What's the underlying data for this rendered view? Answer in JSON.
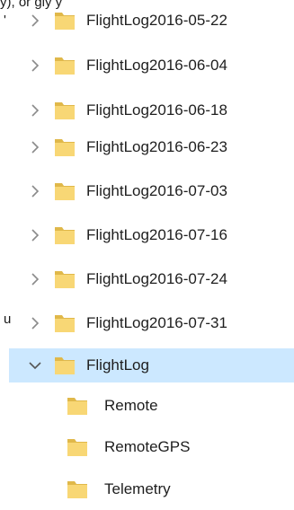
{
  "background_text": {
    "fragment_1": "y), or     gly y",
    "fragment_2": "'",
    "fragment_3": "u"
  },
  "tree": {
    "items": [
      {
        "label": "FlightLog2016-05-22",
        "expanded": false,
        "selected": false
      },
      {
        "label": "FlightLog2016-06-04",
        "expanded": false,
        "selected": false
      },
      {
        "label": "FlightLog2016-06-18",
        "expanded": false,
        "selected": false
      },
      {
        "label": "FlightLog2016-06-23",
        "expanded": false,
        "selected": false
      },
      {
        "label": "FlightLog2016-07-03",
        "expanded": false,
        "selected": false
      },
      {
        "label": "FlightLog2016-07-16",
        "expanded": false,
        "selected": false
      },
      {
        "label": "FlightLog2016-07-24",
        "expanded": false,
        "selected": false
      },
      {
        "label": "FlightLog2016-07-31",
        "expanded": false,
        "selected": false
      },
      {
        "label": "FlightLog",
        "expanded": true,
        "selected": true
      }
    ],
    "children": [
      {
        "label": "Remote"
      },
      {
        "label": "RemoteGPS"
      },
      {
        "label": "Telemetry"
      }
    ]
  },
  "colors": {
    "selection": "#cce8ff",
    "folder": "#f8d775",
    "folder_dark": "#e0b84a",
    "chevron": "#8a8a8a"
  },
  "icons": {
    "collapsed": "chevron-right-icon",
    "expanded": "chevron-down-icon",
    "folder": "folder-icon"
  }
}
